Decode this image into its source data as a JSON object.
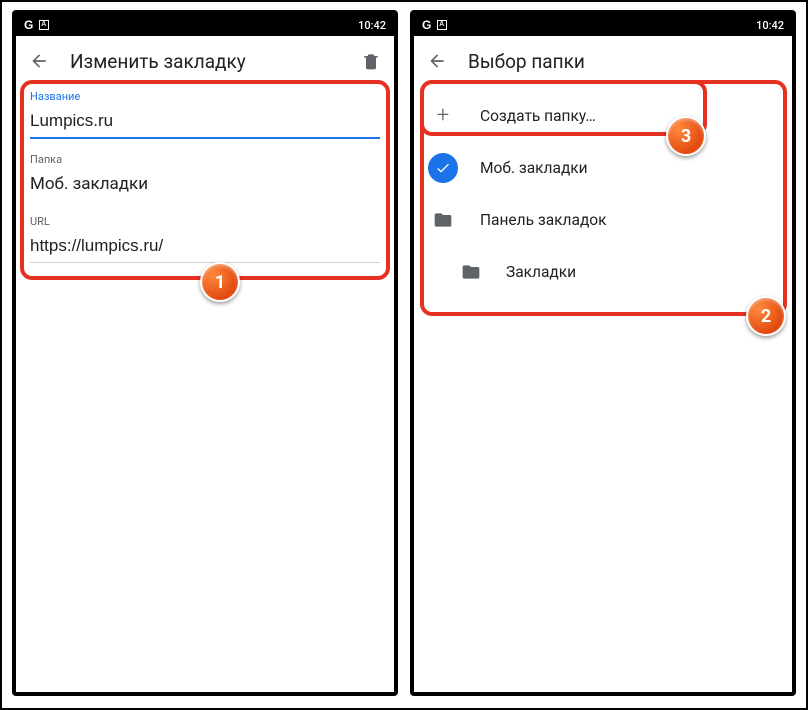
{
  "status": {
    "time": "10:42"
  },
  "left": {
    "title": "Изменить закладку",
    "labels": {
      "name": "Название",
      "folder": "Папка",
      "url": "URL"
    },
    "values": {
      "name": "Lumpics.ru",
      "folder": "Моб. закладки",
      "url": "https://lumpics.ru/"
    }
  },
  "right": {
    "title": "Выбор папки",
    "items": {
      "create": "Создать папку…",
      "mobile": "Моб. закладки",
      "bar": "Панель закладок",
      "bookmarks": "Закладки"
    }
  },
  "callouts": {
    "one": "1",
    "two": "2",
    "three": "3"
  }
}
